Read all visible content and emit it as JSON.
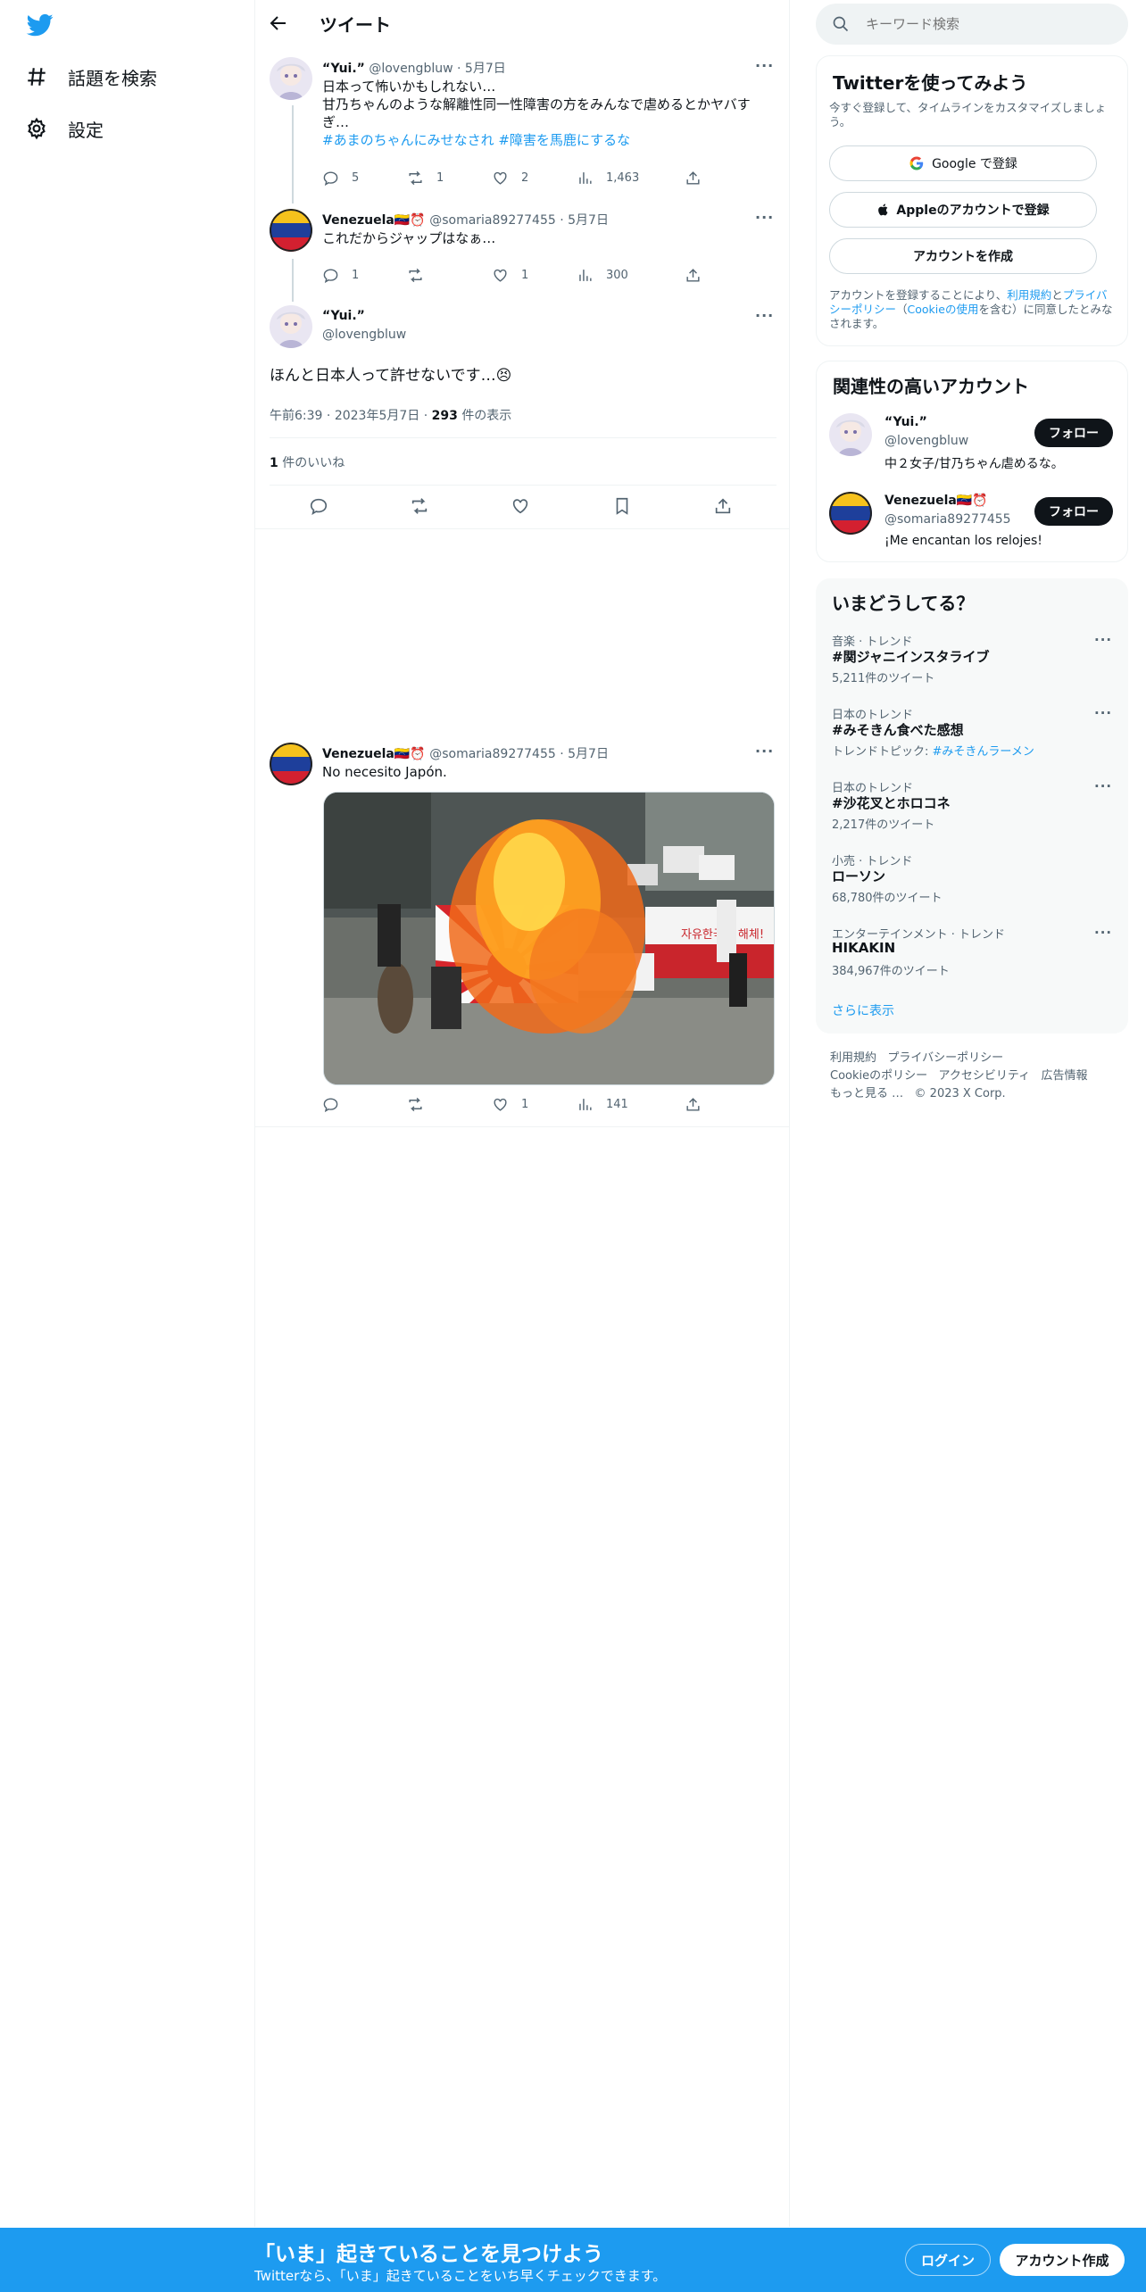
{
  "nav": {
    "explore": "話題を検索",
    "settings": "設定"
  },
  "header": {
    "title": "ツイート"
  },
  "tweet1": {
    "name": "“Yui.”",
    "handle": "@lovengbluw",
    "date": "5月7日",
    "line1": "日本って怖いかもしれない…",
    "line2": "甘乃ちゃんのような解離性同一性障害の方をみんなで虐めるとかヤバすぎ…",
    "hashtag1": "#あまのちゃんにみせなされ",
    "hashtag2": "#障害を馬鹿にするな",
    "replies": "5",
    "retweets": "1",
    "likes": "2",
    "views": "1,463"
  },
  "tweet2": {
    "name": "Venezuela🇻🇪⏰",
    "handle": "@somaria89277455",
    "date": "5月7日",
    "text": "これだからジャップはなぁ…",
    "replies": "1",
    "retweets": "",
    "likes": "1",
    "views": "300"
  },
  "main_tweet": {
    "name": "“Yui.”",
    "handle": "@lovengbluw",
    "text": "ほんと日本人って許せないです…😣",
    "time": "午前6:39",
    "date": "2023年5月7日",
    "views_num": "293",
    "views_label": "件の表示",
    "likes_num": "1",
    "likes_label": "件のいいね"
  },
  "tweet3": {
    "name": "Venezuela🇻🇪⏰",
    "handle": "@somaria89277455",
    "date": "5月7日",
    "text": "No necesito Japón.",
    "replies": "",
    "retweets": "",
    "likes": "1",
    "views": "141",
    "image_text": "자유한국당 해체!"
  },
  "sidebar": {
    "search_placeholder": "キーワード検索",
    "signup": {
      "title": "Twitterを使ってみよう",
      "subtitle": "今すぐ登録して、タイムラインをカスタマイズしましょう。",
      "google": "Google で登録",
      "apple": "Appleのアカウントで登録",
      "create": "アカウントを作成",
      "terms_prefix": "アカウントを登録することにより、",
      "terms_link": "利用規約",
      "terms_and": "と",
      "privacy_link": "プライバシーポリシー",
      "terms_mid": "（",
      "cookie_link": "Cookieの使用",
      "terms_suffix": "を含む）に同意したとみなされます。"
    },
    "relevant": {
      "title": "関連性の高いアカウント",
      "accounts": [
        {
          "name": "“Yui.”",
          "handle": "@lovengbluw",
          "bio": "中２女子/甘乃ちゃん虐めるな。",
          "follow": "フォロー"
        },
        {
          "name": "Venezuela🇻🇪⏰",
          "handle": "@somaria89277455",
          "bio": "¡Me encantan los relojes!",
          "follow": "フォロー"
        }
      ]
    },
    "trends": {
      "title": "いまどうしてる？",
      "items": [
        {
          "category": "音楽 · トレンド",
          "name": "#関ジャニインスタライブ",
          "count": "5,211件のツイート"
        },
        {
          "category": "日本のトレンド",
          "name": "#みそきん食べた感想",
          "count_prefix": "トレンドトピック: ",
          "count_link": "#みそきんラーメン"
        },
        {
          "category": "日本のトレンド",
          "name": "#沙花叉とホロコネ",
          "count": "2,217件のツイート"
        },
        {
          "category": "小売 · トレンド",
          "name": "ローソン",
          "count": "68,780件のツイート"
        },
        {
          "category": "エンターテインメント · トレンド",
          "name": "HIKAKIN",
          "count": "384,967件のツイート"
        }
      ],
      "show_more": "さらに表示"
    },
    "footer": {
      "terms": "利用規約",
      "privacy": "プライバシーポリシー",
      "cookie": "Cookieのポリシー",
      "accessibility": "アクセシビリティ",
      "ads": "広告情報",
      "more": "もっと見る …",
      "copyright": "© 2023 X Corp."
    }
  },
  "bottom_bar": {
    "title": "「いま」起きていることを見つけよう",
    "subtitle": "Twitterなら、「いま」起きていることをいち早くチェックできます。",
    "login": "ログイン",
    "signup": "アカウント作成"
  },
  "colors": {
    "accent": "#1d9bf0",
    "text": "#0f1419",
    "muted": "#536471",
    "border": "#eff3f4"
  }
}
